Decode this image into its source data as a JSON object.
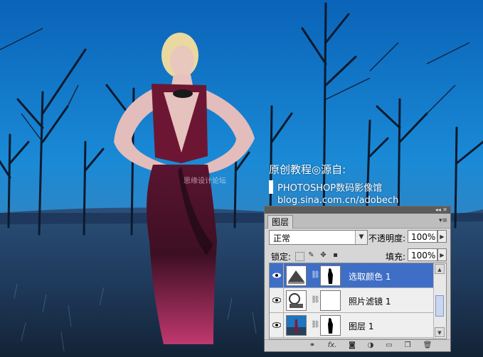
{
  "watermark": {
    "line1": "原创教程◎源自:",
    "line2": "PHOTOSHOP数码影像馆",
    "line3": "blog.sina.com.cn/adobech",
    "faint": "思缘设计论坛"
  },
  "layers_panel": {
    "tab_label": "图层",
    "blend_mode": "正常",
    "opacity_label": "不透明度:",
    "opacity_value": "100%",
    "lock_label": "锁定:",
    "fill_label": "填充:",
    "fill_value": "100%",
    "layers": [
      {
        "name": "选取颜色 1",
        "type": "adjustment-selective-color",
        "selected": true,
        "visible": true
      },
      {
        "name": "照片滤镜 1",
        "type": "adjustment-photo-filter",
        "selected": false,
        "visible": true
      },
      {
        "name": "图层 1",
        "type": "pixel-layer",
        "selected": false,
        "visible": true
      }
    ],
    "bottom_icons": [
      "link-icon",
      "fx-icon",
      "mask-icon",
      "adjustment-icon",
      "group-folder-icon",
      "new-layer-icon",
      "trash-icon"
    ],
    "fx_text": "fx."
  },
  "colors": {
    "selected_row": "#3f6ec6",
    "panel_bg": "#d6d6d6",
    "sky": "#1a8ad6"
  }
}
